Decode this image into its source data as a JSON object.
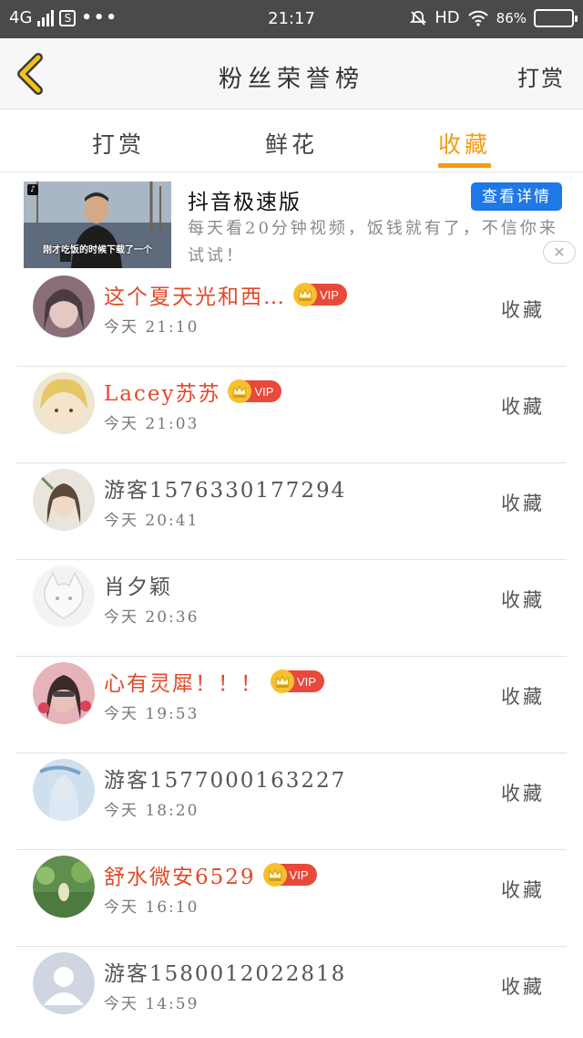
{
  "status_bar": {
    "network": "4G",
    "sim_badge": "S",
    "menu_dots": "•••",
    "time": "21:17",
    "hd_label": "HD",
    "battery_text": "86%",
    "battery_level": 0.86
  },
  "header": {
    "title": "粉丝荣誉榜",
    "action_label": "打赏"
  },
  "tabs": [
    {
      "label": "打赏",
      "active": false
    },
    {
      "label": "鲜花",
      "active": false
    },
    {
      "label": "收藏",
      "active": true
    }
  ],
  "ad": {
    "title": "抖音极速版",
    "button_label": "查看详情",
    "description": "每天看20分钟视频，饭钱就有了，不信你来试试！",
    "thumbnail_caption": "刚才吃饭的时候下载了一个",
    "close_symbol": "✕"
  },
  "vip_label": "VIP",
  "list": [
    {
      "name": "这个夏天光和西…",
      "time": "今天  21:10",
      "vip": true,
      "action": "收藏",
      "avatar": "#c7a8a8"
    },
    {
      "name": "Lacey苏苏",
      "time": "今天  21:03",
      "vip": true,
      "action": "收藏",
      "avatar": "#d9c89a"
    },
    {
      "name": "游客1576330177294",
      "time": "今天  20:41",
      "vip": false,
      "action": "收藏",
      "avatar": "#b9b0a2"
    },
    {
      "name": "肖夕颖",
      "time": "今天  20:36",
      "vip": false,
      "action": "收藏",
      "avatar": "#ececec"
    },
    {
      "name": "心有灵犀！！！",
      "time": "今天  19:53",
      "vip": true,
      "action": "收藏",
      "avatar": "#c98a8c"
    },
    {
      "name": "游客1577000163227",
      "time": "今天  18:20",
      "vip": false,
      "action": "收藏",
      "avatar": "#b8c9dc"
    },
    {
      "name": "舒水微安6529",
      "time": "今天  16:10",
      "vip": true,
      "action": "收藏",
      "avatar": "#7fa665"
    },
    {
      "name": "游客1580012022818",
      "time": "今天  14:59",
      "vip": false,
      "action": "收藏",
      "avatar": "#c9d2de"
    }
  ],
  "colors": {
    "accent": "#f39c12",
    "vip_badge": "#e8493a",
    "vip_name": "#e04a2a",
    "ad_button": "#1e78e6",
    "status_bar": "#4a4a4a"
  }
}
